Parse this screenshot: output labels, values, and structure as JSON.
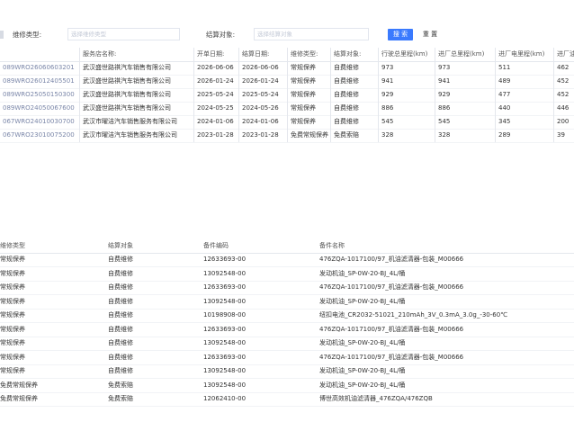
{
  "filters": {
    "repair_type_label": "维修类型:",
    "repair_type_placeholder": "选择维修类型",
    "settle_target_label": "结算对象:",
    "settle_target_placeholder": "选择结算对象",
    "search_label": "搜 索",
    "reset_label": "重 置"
  },
  "table1": {
    "headers": [
      "",
      "服务店名称:",
      "开单日期:",
      "结算日期:",
      "维修类型:",
      "结算对象:",
      "行驶总里程(km)",
      "进厂总里程(km)",
      "进厂电里程(km)",
      "进厂油"
    ],
    "rows": [
      [
        "089WRO26060603201",
        "武汉盛世路祺汽车销售有限公司",
        "2026-06-06",
        "2026-06-06",
        "常规保养",
        "自费维修",
        "973",
        "973",
        "511",
        "462"
      ],
      [
        "089WRO26012405501",
        "武汉盛世路祺汽车销售有限公司",
        "2026-01-24",
        "2026-01-24",
        "常规保养",
        "自费维修",
        "941",
        "941",
        "489",
        "452"
      ],
      [
        "089WRO25050150300",
        "武汉盛世路祺汽车销售有限公司",
        "2025-05-24",
        "2025-05-24",
        "常规保养",
        "自费维修",
        "929",
        "929",
        "477",
        "452"
      ],
      [
        "089WRO24050067600",
        "武汉盛世路祺汽车销售有限公司",
        "2024-05-25",
        "2024-05-26",
        "常规保养",
        "自费维修",
        "886",
        "886",
        "440",
        "446"
      ],
      [
        "067WRO24010030700",
        "武汉市曜洁汽车销售服务有限公司",
        "2024-01-06",
        "2024-01-06",
        "常规保养",
        "自费维修",
        "545",
        "545",
        "345",
        "200"
      ],
      [
        "067WRO23010075200",
        "武汉市曜洁汽车销售服务有限公司",
        "2023-01-28",
        "2023-01-28",
        "免费常规保养",
        "免费索赔",
        "328",
        "328",
        "289",
        "39"
      ]
    ]
  },
  "table2": {
    "headers": [
      "维修类型",
      "结算对象",
      "备件编码",
      "备件名称"
    ],
    "rows": [
      [
        "常规保养",
        "自费维修",
        "12633693-00",
        "476ZQA-1017100/97_机油滤清器-包装_M00666"
      ],
      [
        "常规保养",
        "自费维修",
        "13092548-00",
        "发动机油_SP-0W-20-BJ_4L/桶"
      ],
      [
        "常规保养",
        "自费维修",
        "12633693-00",
        "476ZQA-1017100/97_机油滤清器-包装_M00666"
      ],
      [
        "常规保养",
        "自费维修",
        "13092548-00",
        "发动机油_SP-0W-20-BJ_4L/桶"
      ],
      [
        "常规保养",
        "自费维修",
        "10198908-00",
        "纽扣电池_CR2032-51021_210mAh_3V_0.3mA_3.0g_-30-60℃"
      ],
      [
        "常规保养",
        "自费维修",
        "12633693-00",
        "476ZQA-1017100/97_机油滤清器-包装_M00666"
      ],
      [
        "常规保养",
        "自费维修",
        "13092548-00",
        "发动机油_SP-0W-20-BJ_4L/桶"
      ],
      [
        "常规保养",
        "自费维修",
        "12633693-00",
        "476ZQA-1017100/97_机油滤清器-包装_M00666"
      ],
      [
        "常规保养",
        "自费维修",
        "13092548-00",
        "发动机油_SP-0W-20-BJ_4L/桶"
      ],
      [
        "免费常规保养",
        "免费索赔",
        "13092548-00",
        "发动机油_SP-0W-20-BJ_4L/桶"
      ],
      [
        "免费常规保养",
        "免费索赔",
        "12062410-00",
        "博世高效机油滤清器_476ZQA/476ZQB"
      ]
    ]
  },
  "colors": {
    "accent": "#3a7afe",
    "id_text": "#7a86a8"
  }
}
